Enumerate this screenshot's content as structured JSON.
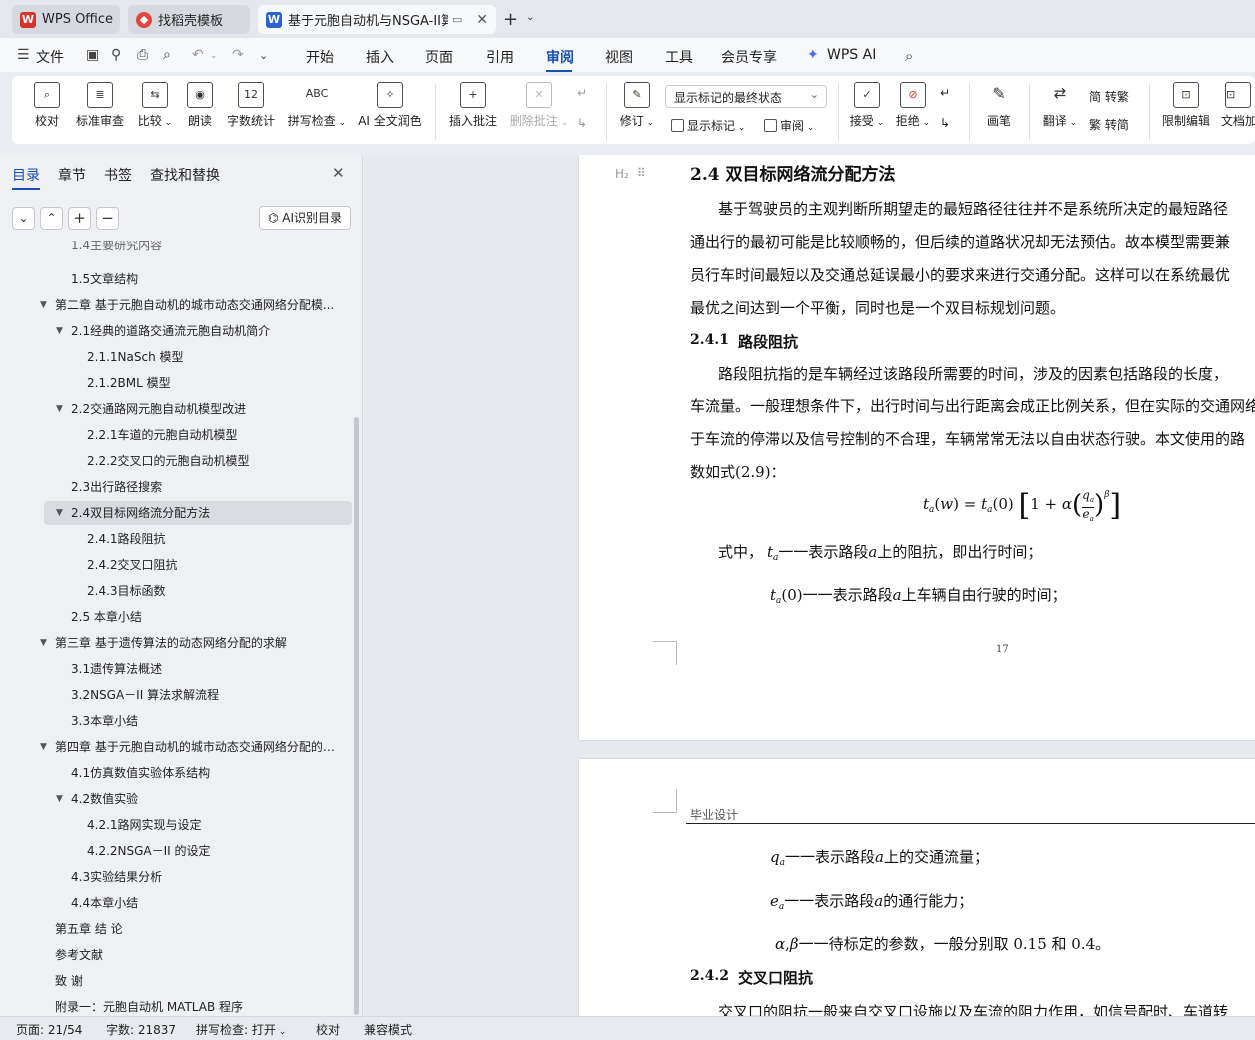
{
  "tabs": [
    {
      "label": "WPS Office",
      "icon": "wps-logo-icon"
    },
    {
      "label": "找稻壳模板",
      "icon": "docer-icon"
    },
    {
      "label": "基于元胞自动机与NSGA-II算",
      "icon": "word-doc-icon"
    }
  ],
  "menu": [
    "文件",
    "开始",
    "插入",
    "页面",
    "引用",
    "审阅",
    "视图",
    "工具",
    "会员专享",
    "WPS AI"
  ],
  "ribbon": {
    "proofread": "校对",
    "standard_review": "标准审查",
    "compare": "比较",
    "read_aloud": "朗读",
    "word_count": "字数统计",
    "spell_check": "拼写检查",
    "ai_polish": "AI 全文润色",
    "insert_comment": "插入批注",
    "delete_comment": "删除批注",
    "track_changes": "修订",
    "markup_view": "显示标记的最终状态",
    "show_markup": "显示标记",
    "review_pane": "审阅",
    "accept": "接受",
    "reject": "拒绝",
    "ink": "画笔",
    "translate": "翻译",
    "to_traditional": "简 转繁",
    "to_simplified": "繁 转简",
    "restrict_edit": "限制编辑",
    "doc_encrypt": "文档加"
  },
  "sidebar": {
    "tabs": [
      "目录",
      "章节",
      "书签",
      "查找和替换"
    ],
    "ai_toc": "AI识别目录",
    "toc": [
      {
        "label": "1.4主要研究内容",
        "level": 2,
        "arrow": false,
        "selected": false
      },
      {
        "label": "1.5文章结构",
        "level": 2,
        "arrow": false,
        "selected": false
      },
      {
        "label": "第二章 基于元胞自动机的城市动态交通网络分配模...",
        "level": 1,
        "arrow": true,
        "selected": false
      },
      {
        "label": "2.1经典的道路交通流元胞自动机简介",
        "level": 2,
        "arrow": true,
        "selected": false
      },
      {
        "label": "2.1.1NaSch 模型",
        "level": 3,
        "arrow": false,
        "selected": false
      },
      {
        "label": "2.1.2BML 模型",
        "level": 3,
        "arrow": false,
        "selected": false
      },
      {
        "label": "2.2交通路网元胞自动机模型改进",
        "level": 2,
        "arrow": true,
        "selected": false
      },
      {
        "label": "2.2.1车道的元胞自动机模型",
        "level": 3,
        "arrow": false,
        "selected": false
      },
      {
        "label": "2.2.2交叉口的元胞自动机模型",
        "level": 3,
        "arrow": false,
        "selected": false
      },
      {
        "label": "2.3出行路径搜索",
        "level": 2,
        "arrow": false,
        "selected": false
      },
      {
        "label": "2.4双目标网络流分配方法",
        "level": 2,
        "arrow": true,
        "selected": true
      },
      {
        "label": "2.4.1路段阻抗",
        "level": 3,
        "arrow": false,
        "selected": false
      },
      {
        "label": "2.4.2交叉口阻抗",
        "level": 3,
        "arrow": false,
        "selected": false
      },
      {
        "label": "2.4.3目标函数",
        "level": 3,
        "arrow": false,
        "selected": false
      },
      {
        "label": "2.5 本章小结",
        "level": 2,
        "arrow": false,
        "selected": false
      },
      {
        "label": "第三章 基于遗传算法的动态网络分配的求解",
        "level": 1,
        "arrow": true,
        "selected": false
      },
      {
        "label": "3.1遗传算法概述",
        "level": 2,
        "arrow": false,
        "selected": false
      },
      {
        "label": "3.2NSGA－II 算法求解流程",
        "level": 2,
        "arrow": false,
        "selected": false
      },
      {
        "label": "3.3本章小结",
        "level": 2,
        "arrow": false,
        "selected": false
      },
      {
        "label": "第四章 基于元胞自动机的城市动态交通网络分配的数值...",
        "level": 1,
        "arrow": true,
        "selected": false
      },
      {
        "label": "4.1仿真数值实验体系结构",
        "level": 2,
        "arrow": false,
        "selected": false
      },
      {
        "label": "4.2数值实验",
        "level": 2,
        "arrow": true,
        "selected": false
      },
      {
        "label": "4.2.1路网实现与设定",
        "level": 3,
        "arrow": false,
        "selected": false
      },
      {
        "label": "4.2.2NSGA－II 的设定",
        "level": 3,
        "arrow": false,
        "selected": false
      },
      {
        "label": "4.3实验结果分析",
        "level": 2,
        "arrow": false,
        "selected": false
      },
      {
        "label": "4.4本章小结",
        "level": 2,
        "arrow": false,
        "selected": false
      },
      {
        "label": "第五章 结 论",
        "level": 1,
        "arrow": false,
        "selected": false
      },
      {
        "label": "参考文献",
        "level": 1,
        "arrow": false,
        "selected": false
      },
      {
        "label": "致 谢",
        "level": 1,
        "arrow": false,
        "selected": false
      },
      {
        "label": "附录一：元胞自动机 MATLAB 程序",
        "level": 1,
        "arrow": false,
        "selected": false
      }
    ]
  },
  "document": {
    "heading_style_tag": "H₂",
    "section_heading": "2.4  双目标网络流分配方法",
    "para1": [
      "基于驾驶员的主观判断所期望走的最短路径往往并不是系统所决定的最短路径",
      "通出行的最初可能是比较顺畅的，但后续的道路状况却无法预估。故本模型需要兼",
      "员行车时间最短以及交通总延误最小的要求来进行交通分配。这样可以在系统最优",
      "最优之间达到一个平衡，同时也是一个双目标规划问题。"
    ],
    "sub1_number": "2.4.1",
    "sub1_title": "路段阻抗",
    "para2": [
      "路段阻抗指的是车辆经过该路段所需要的时间，涉及的因素包括路段的长度，",
      "车流量。一般理想条件下，出行时间与出行距离会成正比例关系，但在实际的交通网络",
      "于车流的停滞以及信号控制的不合理，车辆常常无法以自由状态行驶。本文使用的路",
      "数如式(2.9)："
    ],
    "formula_where": "式中，",
    "def_ta": "一一表示路段",
    "def_ta_tail": "上的阻抗，即出行时间；",
    "def_t0": "一一表示路段",
    "def_t0_tail": "上车辆自由行驶的时间；",
    "page_number": "17",
    "header_text": "毕业设计",
    "def_qa": "一一表示路段",
    "def_qa_tail": "上的交通流量；",
    "def_ea": "一一表示路段",
    "def_ea_tail": "的通行能力；",
    "def_ab": "一一待标定的参数，一般分别取  0.15 和  0.4。",
    "sub2_number": "2.4.2",
    "sub2_title": "交叉口阻抗",
    "para3_partial": "交叉口的阻抗一般来自交叉口设施以及车流的阻力作用，如信号配时、车道转"
  },
  "status": {
    "page": "页面: 21/54",
    "words": "字数: 21837",
    "spell": "拼写检查: 打开",
    "proof": "校对",
    "compat": "兼容模式"
  }
}
